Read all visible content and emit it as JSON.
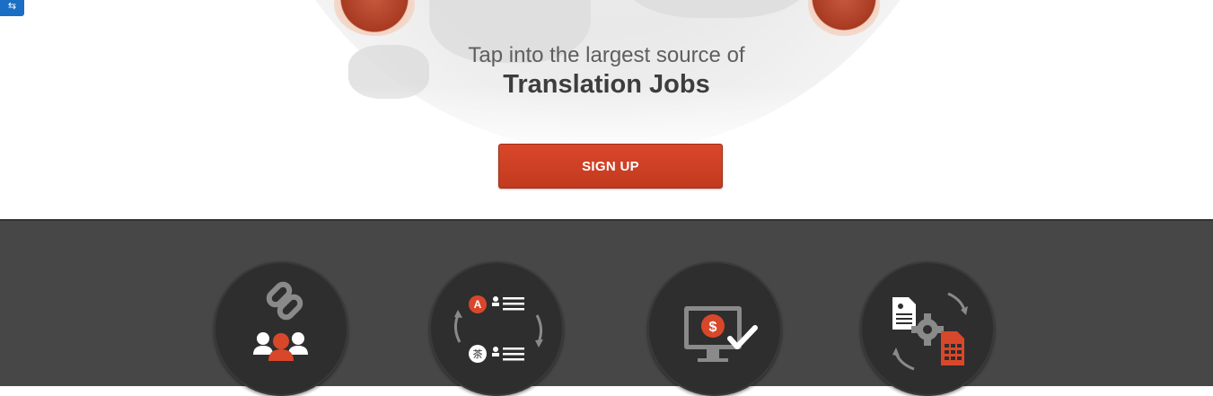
{
  "hero": {
    "tagline": "Tap into the largest source of",
    "headline": "Translation Jobs",
    "signup_label": "SIGN UP",
    "side_tab_icon": "share-icon"
  },
  "features": [
    {
      "icon": "linked-users-icon"
    },
    {
      "icon": "language-exchange-icon"
    },
    {
      "icon": "monitor-payment-icon"
    },
    {
      "icon": "document-processing-icon"
    }
  ],
  "colors": {
    "accent": "#d9472a",
    "dark_band": "#474747",
    "feature_circle": "#2e2e2e",
    "side_tab": "#1a6fc4"
  }
}
